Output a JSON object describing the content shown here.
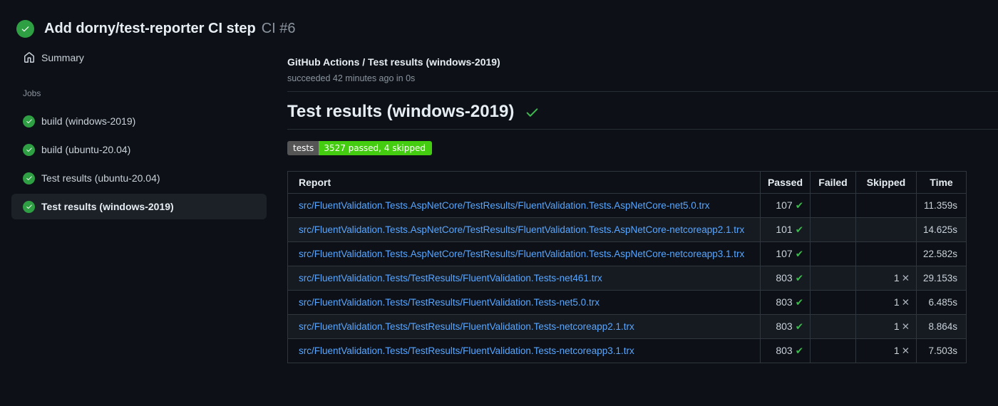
{
  "run_header": {
    "title": "Add dorny/test-reporter CI step",
    "run_number": "CI #6",
    "status": "success"
  },
  "sidebar": {
    "summary_label": "Summary",
    "jobs_section_label": "Jobs",
    "jobs": [
      {
        "label": "build (windows-2019)",
        "status": "success",
        "selected": false
      },
      {
        "label": "build (ubuntu-20.04)",
        "status": "success",
        "selected": false
      },
      {
        "label": "Test results (ubuntu-20.04)",
        "status": "success",
        "selected": false
      },
      {
        "label": "Test results (windows-2019)",
        "status": "success",
        "selected": true
      }
    ]
  },
  "main": {
    "breadcrumb": "GitHub Actions / Test results (windows-2019)",
    "status_line": "succeeded 42 minutes ago in 0s",
    "heading": "Test results (windows-2019)",
    "badge": {
      "label": "tests",
      "value": "3527 passed, 4 skipped"
    },
    "table": {
      "headers": [
        "Report",
        "Passed",
        "Failed",
        "Skipped",
        "Time"
      ],
      "rows": [
        {
          "report": "src/FluentValidation.Tests.AspNetCore/TestResults/FluentValidation.Tests.AspNetCore-net5.0.trx",
          "passed": "107",
          "passed_icon": "✔",
          "failed": "",
          "skipped": "",
          "skipped_icon": "",
          "time": "11.359s"
        },
        {
          "report": "src/FluentValidation.Tests.AspNetCore/TestResults/FluentValidation.Tests.AspNetCore-netcoreapp2.1.trx",
          "passed": "101",
          "passed_icon": "✔",
          "failed": "",
          "skipped": "",
          "skipped_icon": "",
          "time": "14.625s"
        },
        {
          "report": "src/FluentValidation.Tests.AspNetCore/TestResults/FluentValidation.Tests.AspNetCore-netcoreapp3.1.trx",
          "passed": "107",
          "passed_icon": "✔",
          "failed": "",
          "skipped": "",
          "skipped_icon": "",
          "time": "22.582s"
        },
        {
          "report": "src/FluentValidation.Tests/TestResults/FluentValidation.Tests-net461.trx",
          "passed": "803",
          "passed_icon": "✔",
          "failed": "",
          "skipped": "1",
          "skipped_icon": "✕",
          "time": "29.153s"
        },
        {
          "report": "src/FluentValidation.Tests/TestResults/FluentValidation.Tests-net5.0.trx",
          "passed": "803",
          "passed_icon": "✔",
          "failed": "",
          "skipped": "1",
          "skipped_icon": "✕",
          "time": "6.485s"
        },
        {
          "report": "src/FluentValidation.Tests/TestResults/FluentValidation.Tests-netcoreapp2.1.trx",
          "passed": "803",
          "passed_icon": "✔",
          "failed": "",
          "skipped": "1",
          "skipped_icon": "✕",
          "time": "8.864s"
        },
        {
          "report": "src/FluentValidation.Tests/TestResults/FluentValidation.Tests-netcoreapp3.1.trx",
          "passed": "803",
          "passed_icon": "✔",
          "failed": "",
          "skipped": "1",
          "skipped_icon": "✕",
          "time": "7.503s"
        }
      ]
    }
  },
  "colors": {
    "background": "#0d1117",
    "success_green": "#2ea043",
    "check_green": "#3fb950",
    "link_blue": "#58a6ff",
    "badge_label_bg": "#555555",
    "badge_value_bg": "#44cc11",
    "border": "#30363d",
    "row_alt_bg": "#161b22",
    "selected_item_bg": "#1c2128",
    "muted_text": "#8b949e"
  }
}
